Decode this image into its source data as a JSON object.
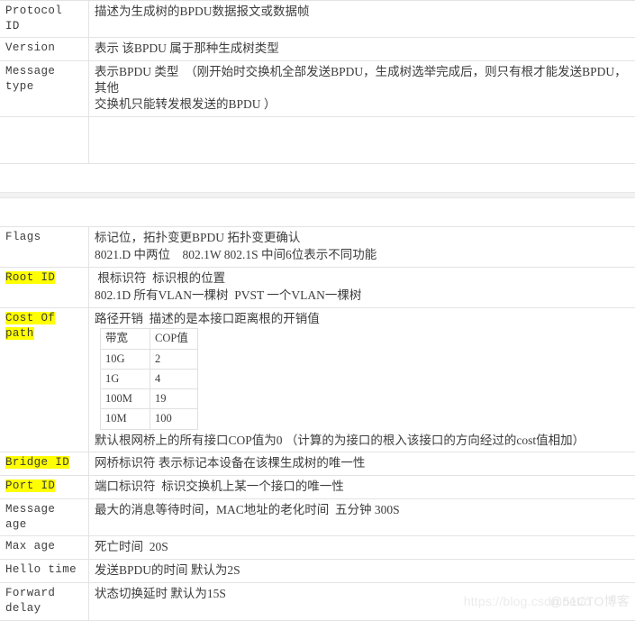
{
  "document": {
    "title_column_label": "field",
    "sections": [
      {
        "name": "upper",
        "rows": [
          {
            "key": "Protocol ID",
            "highlight": false,
            "lines": [
              "描述为生成树的BPDU数据报文或数据帧"
            ]
          },
          {
            "key": "Version",
            "highlight": false,
            "lines": [
              "表示 该BPDU 属于那种生成树类型"
            ]
          },
          {
            "key": "Message type",
            "key_lines": [
              "Message",
              "type"
            ],
            "highlight": false,
            "lines": [
              "表示BPDU 类型  （刚开始时交换机全部发送BPDU，生成树选举完成后，则只有根才能发送BPDU，其他",
              "交换机只能转发根发送的BPDU ）"
            ]
          }
        ]
      },
      {
        "name": "lower",
        "rows": [
          {
            "key": "Flags",
            "highlight": false,
            "lines": [
              "标记位，拓扑变更BPDU 拓扑变更确认",
              "8021.D 中两位    802.1W 802.1S 中间6位表示不同功能"
            ]
          },
          {
            "key": "Root ID",
            "highlight": true,
            "lines": [
              " 根标识符  标识根的位置",
              "802.1D 所有VLAN一棵树  PVST 一个VLAN一棵树"
            ]
          },
          {
            "key": "Cost Of path",
            "key_lines": [
              "Cost Of",
              "path"
            ],
            "highlight": true,
            "lines": [
              "路径开销  描述的是本接口距离根的开销值"
            ],
            "subtable": {
              "headers": [
                "带宽",
                "COP值"
              ],
              "rows": [
                [
                  "10G",
                  "2"
                ],
                [
                  "1G",
                  "4"
                ],
                [
                  "100M",
                  "19"
                ],
                [
                  "10M",
                  "100"
                ]
              ]
            },
            "note": "默认根网桥上的所有接口COP值为0   （计算的为接口的根入该接口的方向经过的cost值相加）"
          },
          {
            "key": "Bridge ID",
            "highlight": true,
            "lines": [
              "网桥标识符 表示标记本设备在该棵生成树的唯一性"
            ]
          },
          {
            "key": "Port ID",
            "highlight": true,
            "lines": [
              "端口标识符  标识交换机上某一个接口的唯一性"
            ]
          },
          {
            "key": "Message age",
            "highlight": false,
            "lines": [
              "最大的消息等待时间，MAC地址的老化时间  五分钟 300S"
            ]
          },
          {
            "key": "Max age",
            "highlight": false,
            "lines": [
              "死亡时间  20S"
            ]
          },
          {
            "key": "Hello time",
            "highlight": false,
            "lines": [
              "发送BPDU的时间 默认为2S"
            ]
          },
          {
            "key": "Forward delay",
            "key_lines": [
              "Forward",
              "delay"
            ],
            "highlight": false,
            "lines": [
              "状态切换延时 默认为15S"
            ]
          }
        ]
      }
    ]
  },
  "watermark": {
    "url_text": "https://blog.csdn.net/o",
    "brand_text": "@51CTO博客"
  },
  "colors": {
    "highlight": "#ffff00",
    "border": "#e3e3e3",
    "text": "#3c3c3c",
    "watermark": "#e9e9e9"
  }
}
